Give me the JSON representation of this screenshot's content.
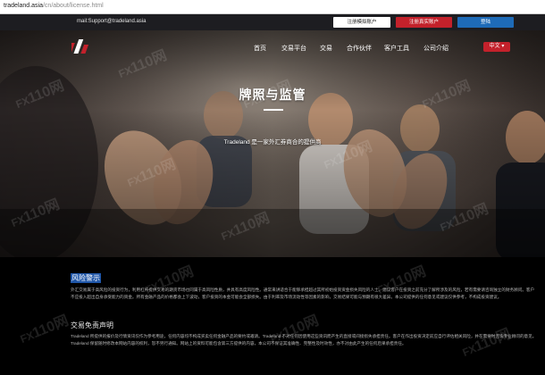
{
  "browser": {
    "url_domain": "tradeland.asia",
    "url_path": "/cn/about/license.html"
  },
  "topbar": {
    "email": "mail:Support@tradeland.asia",
    "buttons": {
      "demo": "注册模拟账户",
      "real": "注册真实账户",
      "login": "登陆"
    }
  },
  "nav": {
    "items": [
      "首页",
      "交易平台",
      "交易",
      "合作伙伴",
      "客户工具",
      "公司介绍"
    ],
    "language": "中文 ▾"
  },
  "hero": {
    "title": "牌照与监管",
    "subtitle": "Tradeland 是一家外汇券商合的提供商"
  },
  "sections": [
    {
      "title": "风险警示",
      "text": "外汇交易属于高风险的投资行为，利用杠杆提供交易的期货市场也同属于高风险性质，并具有高度风险性。通常来讲适合于能够承担超过其所初始投资资金损失风险的人士。建议客户在投资之前充分了解所涉及的风险，若有需要请咨询独立的财务顾问。客户不应投入超出自身承受能力的资金。所有金融产品的价格都会上下波动，客户投资的本金可能会全部损失。由于利率及市场流动性等因素的影响，交易结果可能与预期有很大差异。本公司提供的任何意见或建议仅供参考，不构成投资建议。"
    },
    {
      "title": "交易免责声明",
      "text": "Tradeland 所提供的报价及行情资讯仅作为参考用途，任何内容均不构成买卖任何金融产品的要约或邀请。Tradeland 不对任何因使用这些资讯而产生的直接或间接损失承担责任。客户在作出投资决定前应自行评估相关风险，并在需要时咨询专业顾问的意见。Tradeland 保留随时修改本网站内容的权利，恕不另行通知。网站上的资料可能包含第三方提供的内容，本公司不保证其准确性、完整性及时效性，亦不对由此产生的任何后果承担责任。"
    }
  ],
  "watermark": {
    "text": "110网"
  },
  "colors": {
    "accent_red": "#c3212b",
    "accent_blue": "#1e6bb8",
    "highlight": "#1f56a8",
    "background": "#000000"
  }
}
